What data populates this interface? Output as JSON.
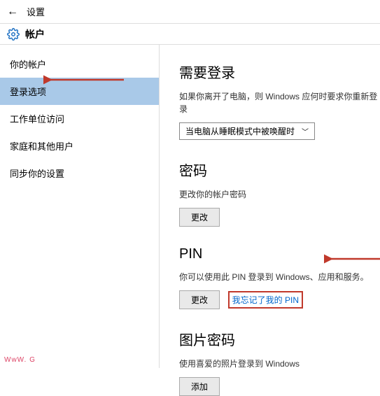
{
  "header": {
    "back_icon": "←",
    "title": "设置"
  },
  "subheader": {
    "title": "帐户"
  },
  "sidebar": {
    "items": [
      {
        "label": "你的帐户"
      },
      {
        "label": "登录选项",
        "selected": true
      },
      {
        "label": "工作单位访问"
      },
      {
        "label": "家庭和其他用户"
      },
      {
        "label": "同步你的设置"
      }
    ]
  },
  "main": {
    "signin": {
      "title": "需要登录",
      "desc": "如果你离开了电脑，则 Windows 应何时要求你重新登录",
      "dropdown_value": "当电脑从睡眠模式中被唤醒时"
    },
    "password": {
      "title": "密码",
      "desc": "更改你的帐户密码",
      "change_btn": "更改"
    },
    "pin": {
      "title": "PIN",
      "desc": "你可以使用此 PIN 登录到 Windows、应用和服务。",
      "change_btn": "更改",
      "forgot_link": "我忘记了我的 PIN"
    },
    "picture_password": {
      "title": "图片密码",
      "desc": "使用喜爱的照片登录到 Windows",
      "add_btn": "添加"
    }
  },
  "watermark": "WwW. G"
}
